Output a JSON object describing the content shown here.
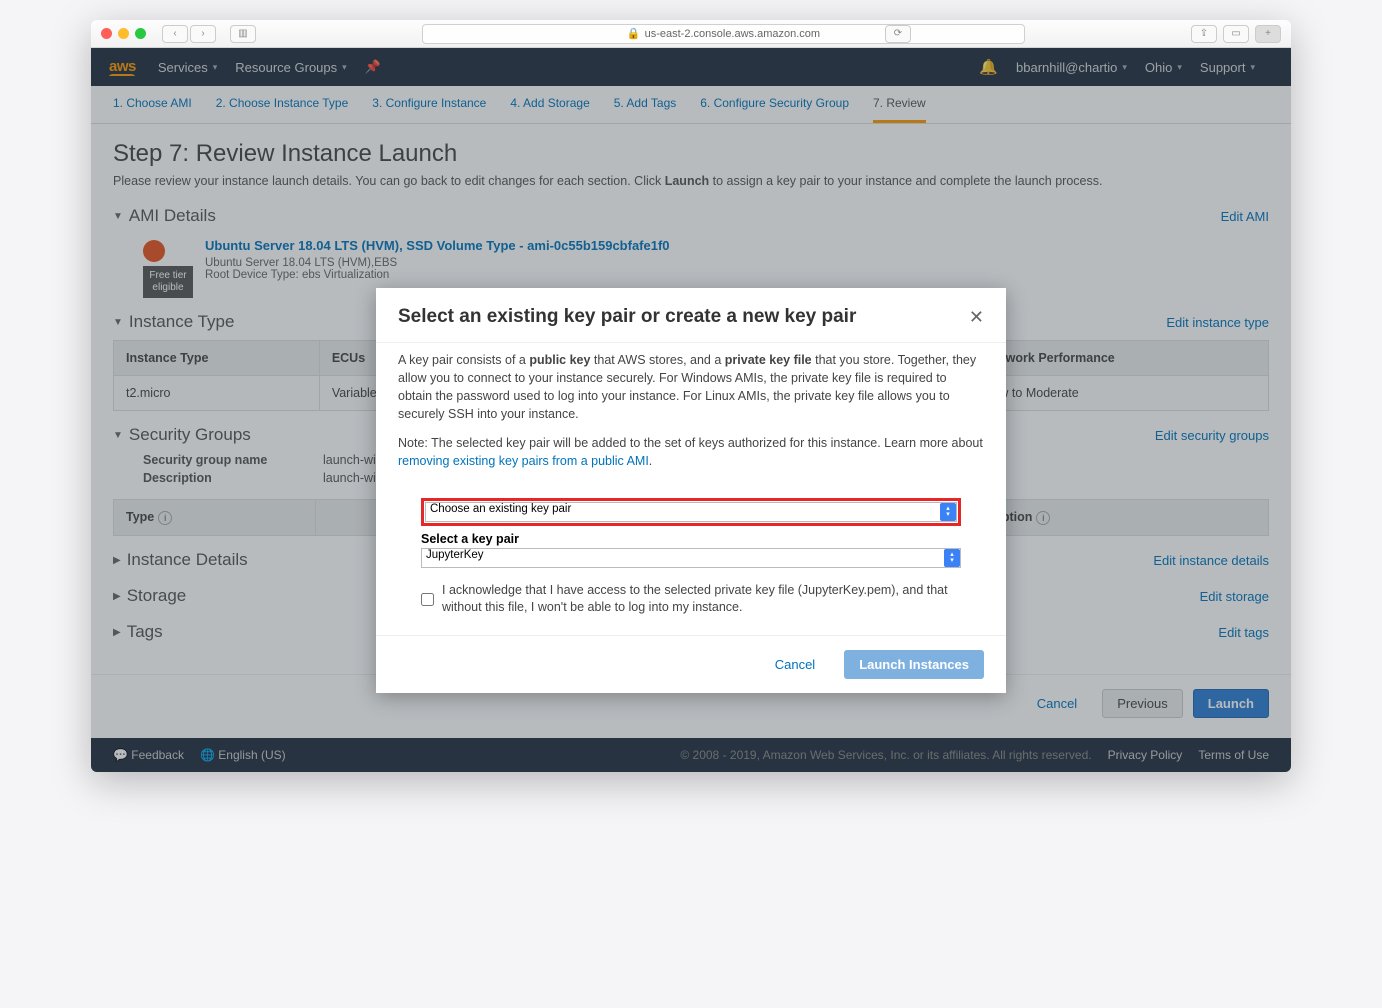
{
  "browser": {
    "url": "us-east-2.console.aws.amazon.com"
  },
  "nav": {
    "logo": "aws",
    "services": "Services",
    "resource_groups": "Resource Groups",
    "user": "bbarnhill@chartio",
    "region": "Ohio",
    "support": "Support"
  },
  "wizard": [
    "1. Choose AMI",
    "2. Choose Instance Type",
    "3. Configure Instance",
    "4. Add Storage",
    "5. Add Tags",
    "6. Configure Security Group",
    "7. Review"
  ],
  "page": {
    "title": "Step 7: Review Instance Launch",
    "lead_a": "Please review your instance launch details. You can go back to edit changes for each section. Click ",
    "lead_b": "Launch",
    "lead_c": " to assign a key pair to your instance and complete the launch process."
  },
  "ami": {
    "section": "AMI Details",
    "edit": "Edit AMI",
    "title": "Ubuntu Server 18.04 LTS (HVM), SSD Volume Type - ami-0c55b159cbfafe1f0",
    "sub1": "Ubuntu Server 18.04 LTS (HVM),EBS",
    "badge": "Free tier eligible",
    "sub2": "Root Device Type: ebs    Virtualization"
  },
  "itype": {
    "section": "Instance Type",
    "edit": "Edit instance type",
    "h1": "Instance Type",
    "h2": "ECUs",
    "h3": "Network Performance",
    "v1": "t2.micro",
    "v2": "Variable",
    "v3": "Low to Moderate"
  },
  "sg": {
    "section": "Security Groups",
    "edit": "Edit security groups",
    "name_l": "Security group name",
    "name_v": "launch-wi",
    "desc_l": "Description",
    "desc_v": "launch-wi",
    "th_type": "Type",
    "th_desc": "Description"
  },
  "collapsed": {
    "idetails": "Instance Details",
    "idetails_edit": "Edit instance details",
    "storage": "Storage",
    "storage_edit": "Edit storage",
    "tags": "Tags",
    "tags_edit": "Edit tags"
  },
  "footer_btns": {
    "cancel": "Cancel",
    "previous": "Previous",
    "launch": "Launch"
  },
  "awsfoot": {
    "feedback": "Feedback",
    "lang": "English (US)",
    "copy": "© 2008 - 2019, Amazon Web Services, Inc. or its affiliates. All rights reserved.",
    "privacy": "Privacy Policy",
    "terms": "Terms of Use"
  },
  "modal": {
    "title": "Select an existing key pair or create a new key pair",
    "p1a": "A key pair consists of a ",
    "p1b": "public key",
    "p1c": " that AWS stores, and a ",
    "p1d": "private key file",
    "p1e": " that you store. Together, they allow you to connect to your instance securely. For Windows AMIs, the private key file is required to obtain the password used to log into your instance. For Linux AMIs, the private key file allows you to securely SSH into your instance.",
    "p2a": "Note: The selected key pair will be added to the set of keys authorized for this instance. Learn more about ",
    "p2link": "removing existing key pairs from a public AMI",
    "p2b": ".",
    "sel1": "Choose an existing key pair",
    "sel2_label": "Select a key pair",
    "sel2": "JupyterKey",
    "ack": "I acknowledge that I have access to the selected private key file (JupyterKey.pem), and that without this file, I won't be able to log into my instance.",
    "cancel": "Cancel",
    "launch": "Launch Instances"
  }
}
